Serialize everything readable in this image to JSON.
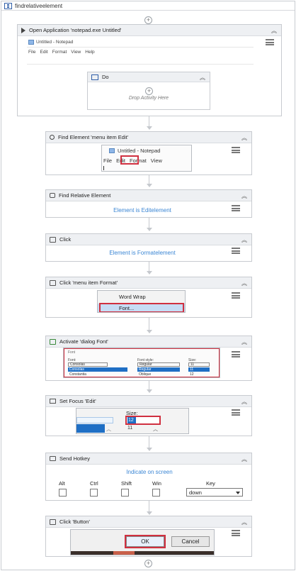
{
  "sequence": {
    "title": "findrelativeelement"
  },
  "open_app": {
    "title": "Open Application 'notepad.exe Untitled'",
    "window_title": "Untitled - Notepad",
    "menu": [
      "File",
      "Edit",
      "Format",
      "View",
      "Help"
    ],
    "do_title": "Do",
    "drop_hint": "Drop Activity Here"
  },
  "find_element": {
    "title": "Find Element 'menu item  Edit'",
    "window_title": "Untitled - Notepad",
    "menu": [
      "File",
      "Edit",
      "Format",
      "View"
    ]
  },
  "find_relative": {
    "title": "Find Relative Element",
    "link": "Element is Editelement"
  },
  "click": {
    "title": "Click",
    "link": "Element is Formatelement"
  },
  "click_format": {
    "title": "Click 'menu item  Format'",
    "items": [
      "Word Wrap",
      "Font..."
    ]
  },
  "activate_font": {
    "title": "Activate 'dialog  Font'",
    "dialog_title": "Font",
    "col_labels": [
      "Font:",
      "Font style:",
      "Size:"
    ],
    "font_list": [
      "Consolas",
      "Consolas",
      "Constantia"
    ],
    "style_list": [
      "Regular",
      "Regular",
      "Oblique"
    ],
    "size_list": [
      "11",
      "11",
      "12"
    ]
  },
  "set_focus": {
    "title": "Set Focus 'Edit'",
    "size_label": "Size:",
    "size_value": "12",
    "size_next": "11"
  },
  "send_hotkey": {
    "title": "Send Hotkey",
    "link": "Indicate on screen",
    "modifiers": [
      "Alt",
      "Ctrl",
      "Shift",
      "Win"
    ],
    "key_label": "Key",
    "key_value": "down"
  },
  "click_button": {
    "title": "Click 'Button'",
    "ok": "OK",
    "cancel": "Cancel"
  },
  "colors": {
    "accent": "#3b86d4",
    "highlight": "#d03040",
    "selection": "#1f6fc5"
  }
}
